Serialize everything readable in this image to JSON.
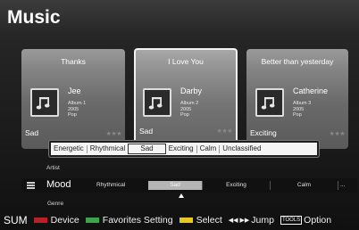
{
  "screen_title": "Music",
  "cards": [
    {
      "title": "Thanks",
      "artist": "Jee",
      "album": "Album 1",
      "year": "2005",
      "genre": "Pop",
      "mood": "Sad",
      "stars": "★★★"
    },
    {
      "title": "I Love You",
      "artist": "Darby",
      "album": "Album 2",
      "year": "2005",
      "genre": "Pop",
      "mood": "Sad",
      "stars": "★★★"
    },
    {
      "title": "Better than yesterday",
      "artist": "Catherine",
      "album": "Album 3",
      "year": "2005",
      "genre": "Pop",
      "mood": "Exciting",
      "stars": "★★★"
    }
  ],
  "mood_popup": {
    "options": [
      "Energetic",
      "Rhythmical",
      "Sad",
      "Exciting",
      "Calm",
      "Unclassified"
    ],
    "selected": "Sad"
  },
  "sort_bar": {
    "above_label": "Artist",
    "current_label": "Mood",
    "below_label": "Genre",
    "columns": [
      "Rhythmical",
      "Sad",
      "Exciting",
      "Calm",
      "..."
    ],
    "highlighted": "Sad"
  },
  "bottom_bar": {
    "sum": "SUM",
    "device": "Device",
    "favorites": "Favorites Setting",
    "select": "Select",
    "jump_arrows": "◀◀ ▶▶",
    "jump": "Jump",
    "tools": "TOOLS",
    "option": "Option"
  },
  "colors": {
    "accent_selected": "#b5b5b5",
    "swatch_red": "#b8202a",
    "swatch_green": "#3fa34d",
    "swatch_yellow": "#e6c81e",
    "swatch_blue": "#2c5fb8"
  },
  "icons": [
    "music-note-icon",
    "menu-lines-icon",
    "caret-up-icon"
  ]
}
